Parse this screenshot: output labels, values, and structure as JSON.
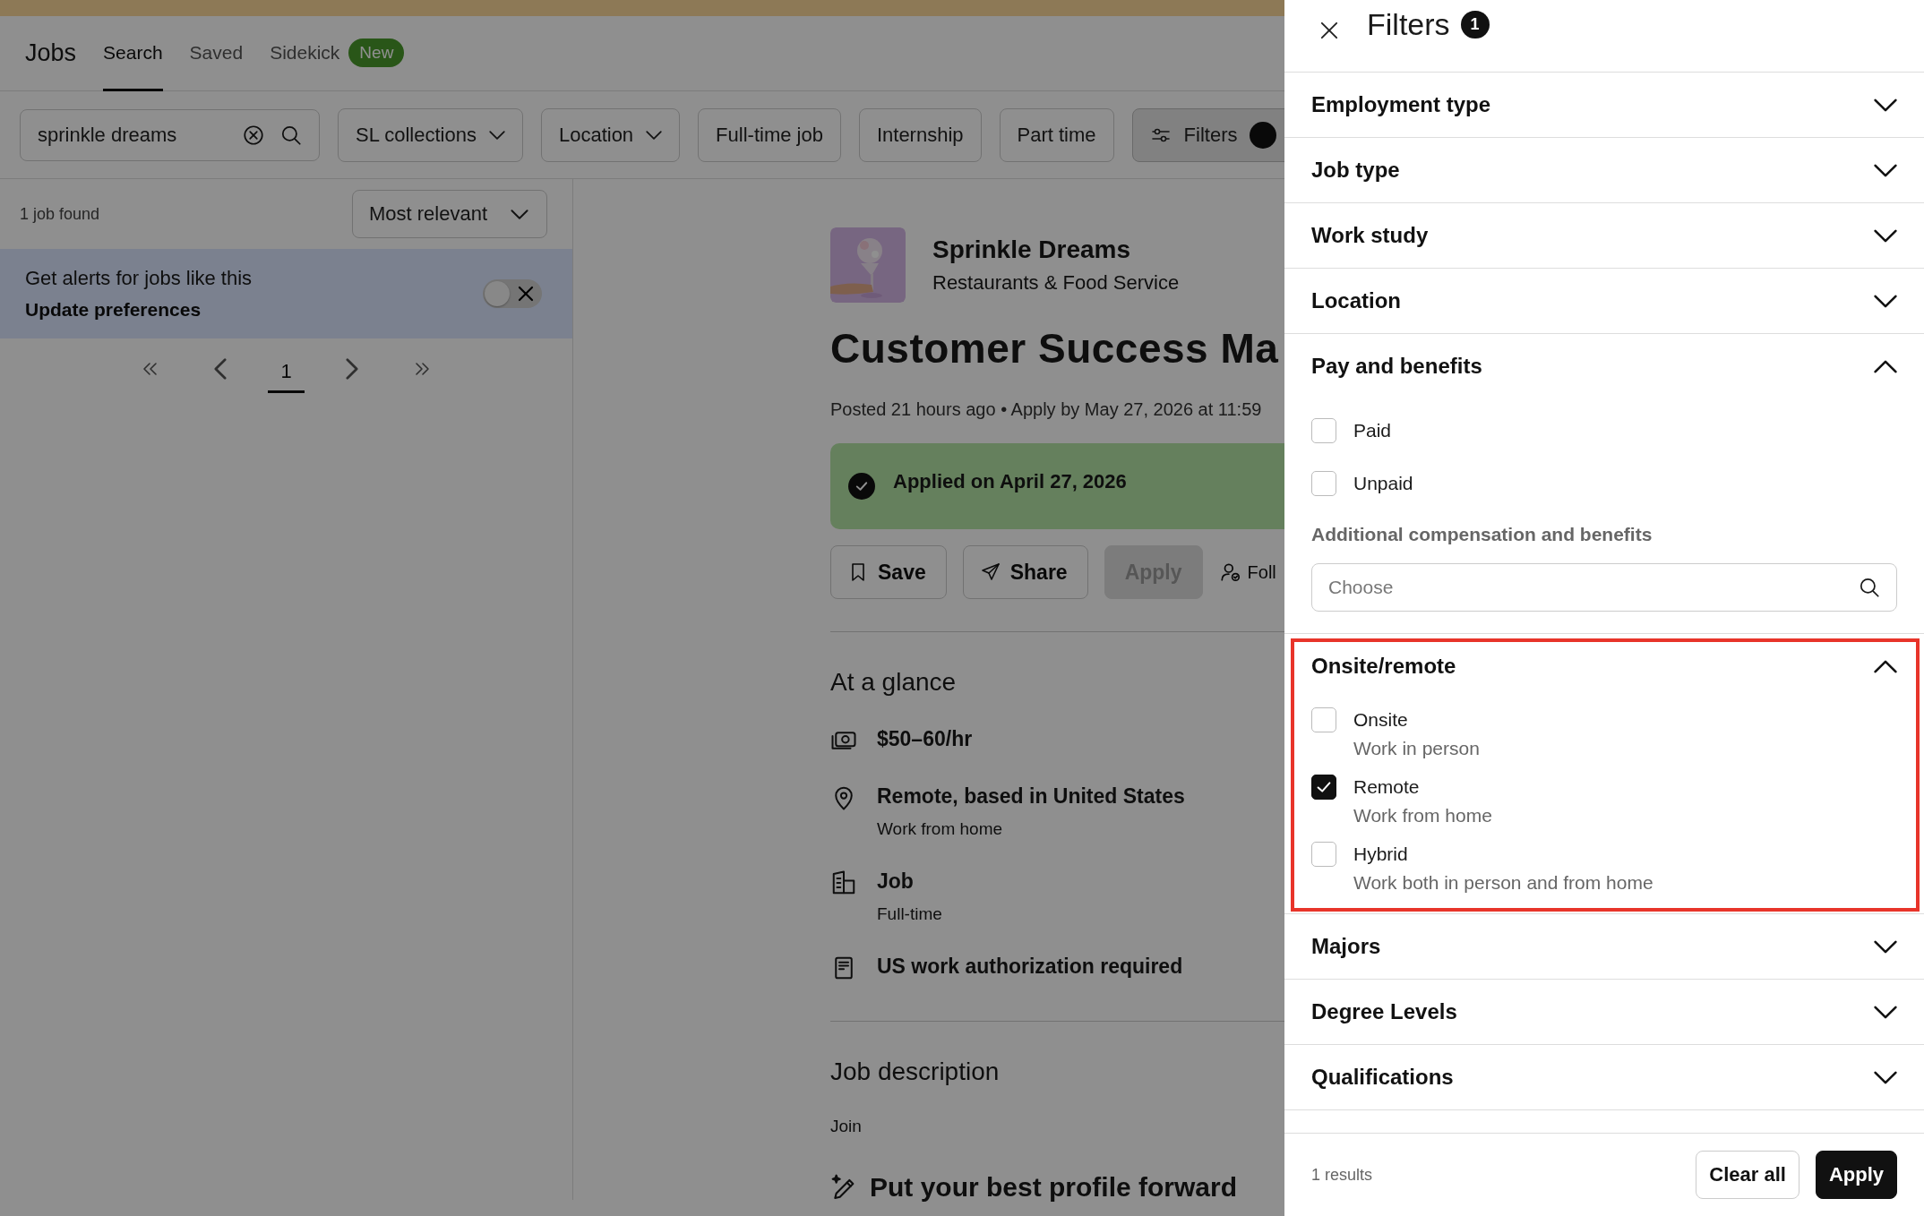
{
  "nav": {
    "title": "Jobs",
    "tabs": [
      {
        "label": "Search",
        "selected": true
      },
      {
        "label": "Saved",
        "selected": false
      },
      {
        "label": "Sidekick",
        "selected": false,
        "badge": "New"
      }
    ]
  },
  "search_bar": {
    "query": "sprinkle dreams",
    "chips": [
      {
        "label": "SL collections",
        "kind": "dropdown"
      },
      {
        "label": "Location",
        "kind": "dropdown"
      },
      {
        "label": "Full-time job",
        "kind": "plain"
      },
      {
        "label": "Internship",
        "kind": "plain"
      },
      {
        "label": "Part time",
        "kind": "plain"
      },
      {
        "label": "Filters",
        "kind": "filters"
      }
    ]
  },
  "results": {
    "count": "1 job found",
    "sort": "Most relevant",
    "alert": {
      "title": "Get alerts for jobs like this",
      "link": "Update preferences",
      "on": false
    },
    "pagination": {
      "pages": [
        {
          "label": "1",
          "selected": true
        }
      ]
    }
  },
  "job": {
    "company": "Sprinkle Dreams",
    "industry": "Restaurants & Food Service",
    "title": "Customer Success Ma",
    "posted": "Posted 21 hours ago • Apply by May 27, 2026 at 11:59",
    "applied": "Applied on April 27, 2026",
    "actions": [
      {
        "label": "Save",
        "kind": "save",
        "disabled": false
      },
      {
        "label": "Share",
        "kind": "share",
        "disabled": false
      },
      {
        "label": "Apply",
        "kind": "apply",
        "disabled": true
      },
      {
        "label": "Foll",
        "kind": "follow",
        "disabled": false
      }
    ],
    "glance_title": "At a glance",
    "glance": [
      {
        "kind": "pay",
        "title": "$50–60/hr"
      },
      {
        "kind": "location",
        "title": "Remote, based in United States",
        "detail": "Work from home"
      },
      {
        "kind": "job",
        "title": "Job",
        "detail": "Full-time"
      },
      {
        "kind": "authorization",
        "title": "US work authorization required"
      }
    ],
    "description_title": "Job description",
    "description": "Join",
    "profile_title": "Put your best profile forward"
  },
  "filters": {
    "title": "Filters",
    "count": "1",
    "sections": [
      {
        "title": "Employment type",
        "expanded": false
      },
      {
        "title": "Job type",
        "expanded": false
      },
      {
        "title": "Work study",
        "expanded": false
      },
      {
        "title": "Location",
        "expanded": false
      },
      {
        "title": "Pay and benefits",
        "expanded": true,
        "options": [
          {
            "label": "Paid",
            "checked": false
          },
          {
            "label": "Unpaid",
            "checked": false
          }
        ],
        "field": {
          "label": "Additional compensation and benefits",
          "placeholder": "Choose"
        }
      },
      {
        "title": "Onsite/remote",
        "expanded": true,
        "highlighted": true,
        "options": [
          {
            "label": "Onsite",
            "detail": "Work in person",
            "checked": false
          },
          {
            "label": "Remote",
            "detail": "Work from home",
            "checked": true
          },
          {
            "label": "Hybrid",
            "detail": "Work both in person and from home",
            "checked": false
          }
        ]
      },
      {
        "title": "Majors",
        "expanded": false
      },
      {
        "title": "Degree Levels",
        "expanded": false
      },
      {
        "title": "Qualifications",
        "expanded": false
      }
    ],
    "results": "1 results",
    "buttons": [
      {
        "label": "Clear all",
        "kind": "secondary"
      },
      {
        "label": "Apply",
        "kind": "primary"
      }
    ]
  }
}
